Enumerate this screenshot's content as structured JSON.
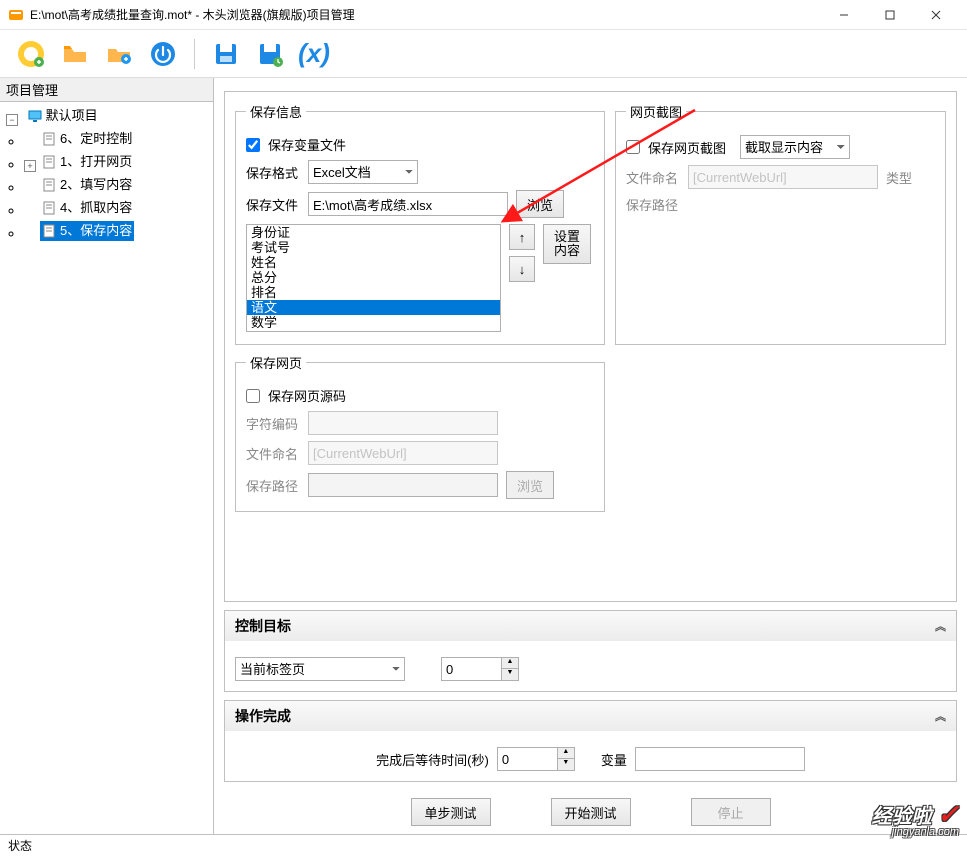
{
  "window": {
    "title": "E:\\mot\\高考成绩批量查询.mot* - 木头浏览器(旗舰版)项目管理"
  },
  "side": {
    "header": "项目管理",
    "root": "默认项目",
    "items": [
      "6、定时控制",
      "1、打开网页",
      "2、填写内容",
      "4、抓取内容",
      "5、保存内容"
    ],
    "selected_index": 4
  },
  "save_info": {
    "legend": "保存信息",
    "save_var_file_label": "保存变量文件",
    "save_var_file_checked": true,
    "format_label": "保存格式",
    "format_value": "Excel文档",
    "file_label": "保存文件",
    "file_value": "E:\\mot\\高考成绩.xlsx",
    "browse": "浏览",
    "set_content": "设置\n内容",
    "list": [
      "身份证",
      "考试号",
      "姓名",
      "总分",
      "排名",
      "语文",
      "数学"
    ],
    "list_selected_index": 5
  },
  "screenshot": {
    "legend": "网页截图",
    "save_label": "保存网页截图",
    "save_checked": false,
    "capture_btn": "截取显示内容",
    "filename_label": "文件命名",
    "filename_value": "[CurrentWebUrl]",
    "type_label": "类型",
    "path_label": "保存路径"
  },
  "save_page": {
    "legend": "保存网页",
    "save_source_label": "保存网页源码",
    "save_source_checked": false,
    "charset_label": "字符编码",
    "filename_label": "文件命名",
    "filename_value": "[CurrentWebUrl]",
    "path_label": "保存路径",
    "browse": "浏览"
  },
  "target": {
    "header": "控制目标",
    "select_value": "当前标签页",
    "number_value": "0"
  },
  "done": {
    "header": "操作完成",
    "wait_label": "完成后等待时间(秒)",
    "wait_value": "0",
    "var_label": "变量"
  },
  "buttons": {
    "step_test": "单步测试",
    "start_test": "开始测试",
    "stop": "停止"
  },
  "statusbar": "状态",
  "watermark": {
    "line1": "经验啦",
    "line2": "jingyanla.com"
  }
}
